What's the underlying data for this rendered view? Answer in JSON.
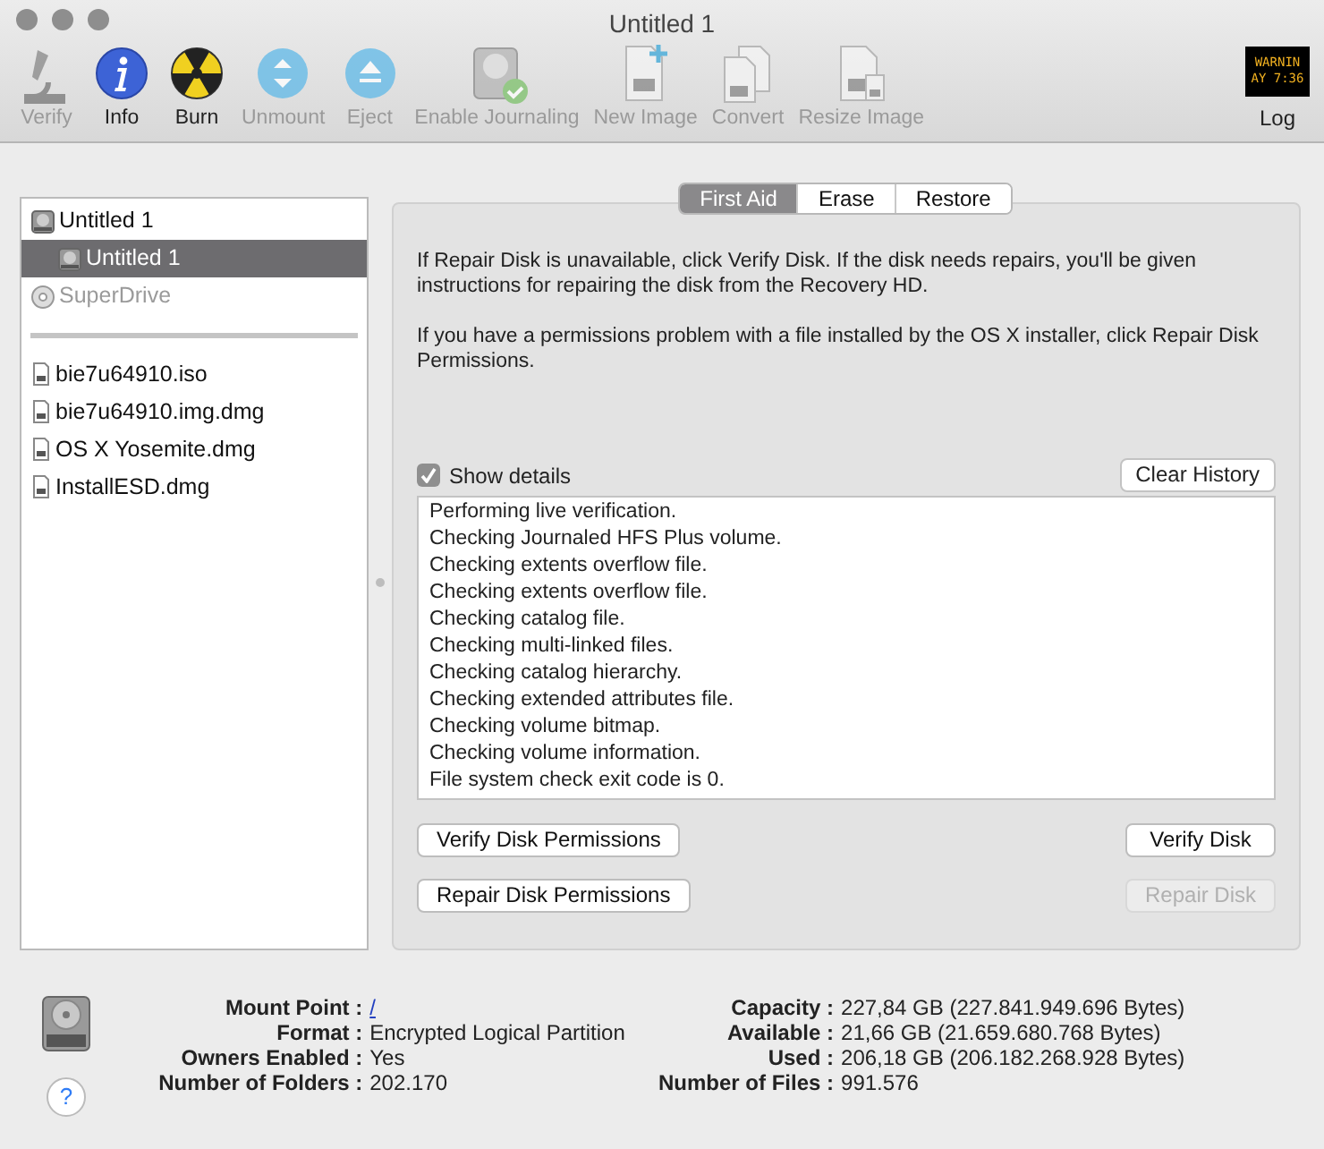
{
  "window": {
    "title": "Untitled 1"
  },
  "toolbar": [
    {
      "label": "Verify",
      "kind": "microscope",
      "disabled": true
    },
    {
      "label": "Info",
      "kind": "info",
      "disabled": false
    },
    {
      "label": "Burn",
      "kind": "burn",
      "disabled": false
    },
    {
      "label": "Unmount",
      "kind": "unmount",
      "disabled": true
    },
    {
      "label": "Eject",
      "kind": "eject",
      "disabled": true
    },
    {
      "label": "Enable Journaling",
      "kind": "journal",
      "disabled": true
    },
    {
      "label": "New Image",
      "kind": "newimage",
      "disabled": true
    },
    {
      "label": "Convert",
      "kind": "convert",
      "disabled": true
    },
    {
      "label": "Resize Image",
      "kind": "resize",
      "disabled": true
    }
  ],
  "log_button": {
    "label": "Log",
    "display": [
      "WARNIN",
      "AY 7:36"
    ]
  },
  "sidebar": {
    "disks": [
      {
        "label": "Untitled 1",
        "kind": "disk",
        "selected": false,
        "disabled": false,
        "children": [
          {
            "label": "Untitled 1",
            "kind": "disk",
            "selected": true,
            "disabled": false
          }
        ]
      },
      {
        "label": "SuperDrive",
        "kind": "optical",
        "selected": false,
        "disabled": true
      }
    ],
    "images": [
      {
        "label": "bie7u64910.iso",
        "selected": false
      },
      {
        "label": "bie7u64910.img.dmg",
        "selected": false
      },
      {
        "label": "OS X Yosemite.dmg",
        "selected": false
      },
      {
        "label": "InstallESD.dmg",
        "selected": false
      }
    ]
  },
  "tabs": [
    {
      "label": "First Aid",
      "selected": true
    },
    {
      "label": "Erase",
      "selected": false
    },
    {
      "label": "Restore",
      "selected": false
    }
  ],
  "first_aid": {
    "paragraphs": [
      "If Repair Disk is unavailable, click Verify Disk. If the disk needs repairs, you'll be given instructions for repairing the disk from the Recovery HD.",
      "If you have a permissions problem with a file installed by the OS X installer, click Repair Disk Permissions."
    ],
    "show_details": {
      "label": "Show details",
      "checked": true
    },
    "clear_history": "Clear History",
    "log": [
      "Performing live verification.",
      "Checking Journaled HFS Plus volume.",
      "Checking extents overflow file.",
      "Checking extents overflow file.",
      "Checking catalog file.",
      "Checking multi-linked files.",
      "Checking catalog hierarchy.",
      "Checking extended attributes file.",
      "Checking volume bitmap.",
      "Checking volume information.",
      "File system check exit code is 0."
    ],
    "buttons": [
      {
        "label": "Verify Disk Permissions",
        "disabled": false
      },
      {
        "label": "Verify Disk",
        "disabled": false
      },
      {
        "label": "Repair Disk Permissions",
        "disabled": false
      },
      {
        "label": "Repair Disk",
        "disabled": true
      }
    ]
  },
  "info": {
    "left": [
      {
        "label": "Mount Point :",
        "value": "/",
        "kind": "link"
      },
      {
        "label": "Format :",
        "value": "Encrypted Logical Partition",
        "kind": "text"
      },
      {
        "label": "Owners Enabled :",
        "value": "Yes",
        "kind": "text"
      },
      {
        "label": "Number of Folders :",
        "value": "202.170",
        "kind": "text"
      }
    ],
    "right": [
      {
        "label": "Capacity :",
        "value": "227,84 GB (227.841.949.696 Bytes)",
        "kind": "text"
      },
      {
        "label": "Available :",
        "value": "21,66 GB (21.659.680.768 Bytes)",
        "kind": "text"
      },
      {
        "label": "Used :",
        "value": "206,18 GB (206.182.268.928 Bytes)",
        "kind": "text"
      },
      {
        "label": "Number of Files :",
        "value": "991.576",
        "kind": "text"
      }
    ],
    "help": "?"
  }
}
